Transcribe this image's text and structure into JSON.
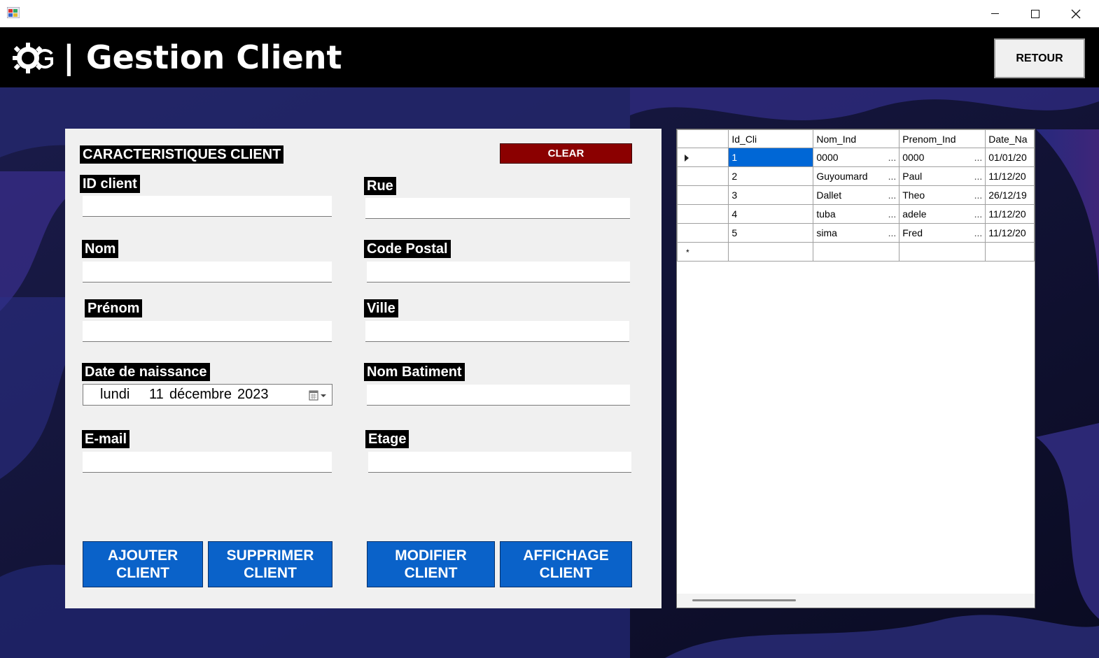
{
  "header": {
    "title": "| Gestion Client",
    "retour_label": "RETOUR",
    "logo_icon": "gear-g-logo-icon"
  },
  "form": {
    "section_title": "CARACTERISTIQUES CLIENT",
    "clear_label": "CLEAR",
    "labels": {
      "id_client": "ID client",
      "nom": "Nom",
      "prenom": "Prénom",
      "date_naissance": "Date de naissance",
      "email": "E-mail",
      "rue": "Rue",
      "code_postal": "Code Postal",
      "ville": "Ville",
      "nom_batiment": "Nom Batiment",
      "etage": "Etage"
    },
    "values": {
      "id_client": "",
      "nom": "",
      "prenom": "",
      "email": "",
      "rue": "",
      "code_postal": "",
      "ville": "",
      "nom_batiment": "",
      "etage": ""
    },
    "date": {
      "day": "lundi",
      "date": "11",
      "month": "décembre",
      "year": "2023"
    },
    "buttons": {
      "ajouter": [
        "AJOUTER",
        "CLIENT"
      ],
      "supprimer": [
        "SUPPRIMER",
        "CLIENT"
      ],
      "modifier": [
        "MODIFIER",
        "CLIENT"
      ],
      "affichage": [
        "AFFICHAGE",
        "CLIENT"
      ]
    }
  },
  "grid": {
    "columns": [
      "Id_Cli",
      "Nom_Ind",
      "Prenom_Ind",
      "Date_Na"
    ],
    "rows": [
      [
        "1",
        "0000",
        "0000",
        "01/01/20"
      ],
      [
        "2",
        "Guyoumard",
        "Paul",
        "11/12/20"
      ],
      [
        "3",
        "Dallet",
        "Theo",
        "26/12/19"
      ],
      [
        "4",
        "tuba",
        "adele",
        "11/12/20"
      ],
      [
        "5",
        "sima",
        "Fred",
        "11/12/20"
      ]
    ],
    "ellipsis": "...",
    "new_row_marker": "*",
    "selected_row": 0
  },
  "colors": {
    "header_bg": "#000000",
    "clear_red": "#8b0000",
    "action_blue": "#0a62c9",
    "selection_blue": "#0067d6",
    "panel_bg": "#f0f0f0"
  }
}
